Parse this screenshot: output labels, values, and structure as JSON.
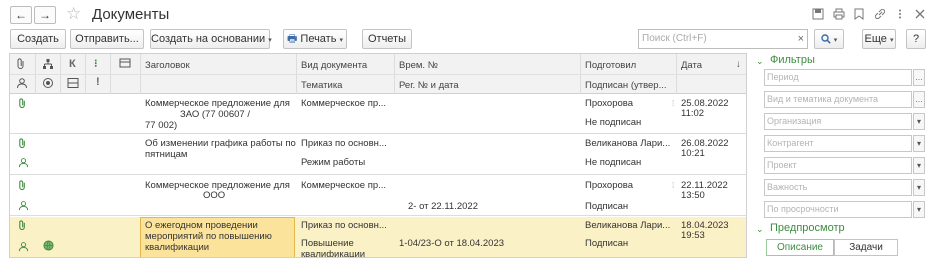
{
  "window": {
    "title": "Документы",
    "nav_back": "←",
    "nav_forward": "→",
    "star": "☆"
  },
  "titlebar_icons": [
    "save-icon",
    "print-icon",
    "bookmark-icon",
    "link-icon",
    "more-icon",
    "close-icon"
  ],
  "toolbar": {
    "create": "Создать",
    "send": "Отправить...",
    "create_based": "Создать на основании",
    "print": "Печать",
    "reports": "Отчеты",
    "search_placeholder": "Поиск (Ctrl+F)",
    "search_clear": "×",
    "search_button": "🔍",
    "more": "Еще",
    "help": "?"
  },
  "table": {
    "columns": {
      "title": "Заголовок",
      "doc_type": "Вид документа",
      "theme": "Тематика",
      "reg_no": "Врем. №",
      "reg_date": "Рег. № и дата",
      "prepared": "Подготовил",
      "signed": "Подписан (утвер...",
      "date": "Дата",
      "sort": "↓"
    },
    "header_icons": {
      "row1": [
        "📎",
        "⊞",
        "К",
        "⁝"
      ],
      "row2": [
        "👤",
        "◎",
        "⊟",
        "!"
      ]
    },
    "rows": [
      {
        "title": "Коммерческое предложение для ЗАО (77 00607 / 77 002)",
        "title_l1": "Коммерческое предложение для",
        "title_l2": "ЗАО (77      00607 /",
        "title_l3": "77        002)",
        "doc_type": "Коммерческое пр...",
        "theme": "",
        "reg": "",
        "prepared": "Прохорова",
        "signed": "Не подписан",
        "date": "25.08.2022",
        "time": "11:02"
      },
      {
        "title_l1": "Об изменении графика работы по",
        "title_l2": "пятницам",
        "title_l3": "",
        "doc_type": "Приказ по основн...",
        "theme": "Режим работы",
        "reg": "",
        "prepared": "Великанова Лари...",
        "signed": "Не подписан",
        "date": "26.08.2022",
        "time": "10:21"
      },
      {
        "title_l1": "Коммерческое предложение для",
        "title_l2": "ООО",
        "title_l3": "",
        "doc_type": "Коммерческое пр...",
        "theme": "",
        "reg": "2- от 22.11.2022",
        "prepared": "Прохорова",
        "signed": "Подписан",
        "date": "22.11.2022",
        "time": "13:50"
      },
      {
        "title_l1": "О ежегодном проведении",
        "title_l2": "мероприятий по повышению",
        "title_l3": "квалификации",
        "doc_type": "Приказ по основн...",
        "theme": "Повышение",
        "theme_l2": "квалификации",
        "reg": "1-04/23-О от 18.04.2023",
        "prepared": "Великанова Лари...",
        "signed": "Подписан",
        "date": "18.04.2023",
        "time": "19:53"
      }
    ]
  },
  "filters": {
    "header": "Фильтры",
    "fields": [
      "Период",
      "Вид и тематика документа",
      "Организация",
      "Контрагент",
      "Проект",
      "Важность",
      "По просрочности"
    ]
  },
  "preview": {
    "header": "Предпросмотр",
    "tab_description": "Описание",
    "tab_tasks": "Задачи"
  },
  "colors": {
    "accent_green": "#3d8c40",
    "selected_row": "#fbf1c7",
    "selected_cell": "#fbe39b"
  }
}
